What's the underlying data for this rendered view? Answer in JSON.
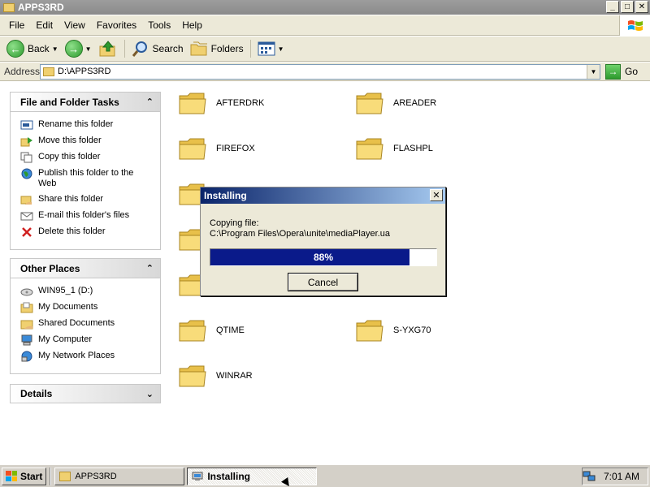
{
  "window": {
    "title": "APPS3RD",
    "minimize": "_",
    "maximize": "□",
    "close": "✕"
  },
  "menu": [
    "File",
    "Edit",
    "View",
    "Favorites",
    "Tools",
    "Help"
  ],
  "toolbar": {
    "back": "Back",
    "search": "Search",
    "folders": "Folders"
  },
  "address": {
    "label": "Address",
    "value": "D:\\APPS3RD",
    "go": "Go"
  },
  "tasks_panel": {
    "title": "File and Folder Tasks",
    "items": [
      {
        "label": "Rename this folder",
        "icon": "rename-icon"
      },
      {
        "label": "Move this folder",
        "icon": "move-icon"
      },
      {
        "label": "Copy this folder",
        "icon": "copy-icon"
      },
      {
        "label": "Publish this folder to the Web",
        "icon": "globe-icon"
      },
      {
        "label": "Share this folder",
        "icon": "share-icon"
      },
      {
        "label": "E-mail this folder's files",
        "icon": "email-icon"
      },
      {
        "label": "Delete this folder",
        "icon": "delete-icon"
      }
    ]
  },
  "places_panel": {
    "title": "Other Places",
    "items": [
      {
        "label": "WIN95_1 (D:)",
        "icon": "drive-icon"
      },
      {
        "label": "My Documents",
        "icon": "documents-icon"
      },
      {
        "label": "Shared Documents",
        "icon": "shared-documents-icon"
      },
      {
        "label": "My Computer",
        "icon": "computer-icon"
      },
      {
        "label": "My Network Places",
        "icon": "network-icon"
      }
    ]
  },
  "details_panel": {
    "title": "Details"
  },
  "folders": [
    "AFTERDRK",
    "AREADER",
    "FIREFOX",
    "FLASHPL",
    "QTIME",
    "S-YXG70",
    "WINRAR"
  ],
  "dialog": {
    "title": "Installing",
    "line1": "Copying file:",
    "line2": "C:\\Program Files\\Opera\\unite\\mediaPlayer.ua",
    "progress_percent": 88,
    "progress_label": "88%",
    "cancel": "Cancel"
  },
  "taskbar": {
    "start": "Start",
    "tasks": [
      "APPS3RD",
      "Installing"
    ],
    "clock": "7:01 AM"
  }
}
